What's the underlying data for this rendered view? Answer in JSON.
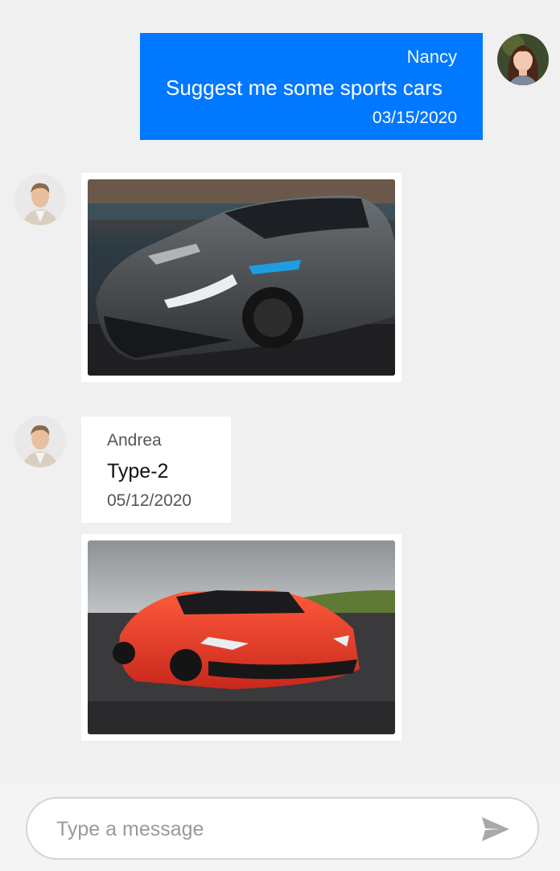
{
  "messages": {
    "outgoing": {
      "author": "Nancy",
      "text": "Suggest me some sports cars",
      "date": "03/15/2020"
    },
    "image_1": {
      "subject": "grey sports car"
    },
    "incoming": {
      "author": "Andrea",
      "text": "Type-2",
      "date": "05/12/2020"
    },
    "image_2": {
      "subject": "red sports car"
    }
  },
  "composer": {
    "placeholder": "Type a message",
    "send_icon": "send-icon"
  },
  "colors": {
    "outgoing_bubble": "#0078ff",
    "background": "#f0f0f0",
    "card": "#ffffff"
  }
}
